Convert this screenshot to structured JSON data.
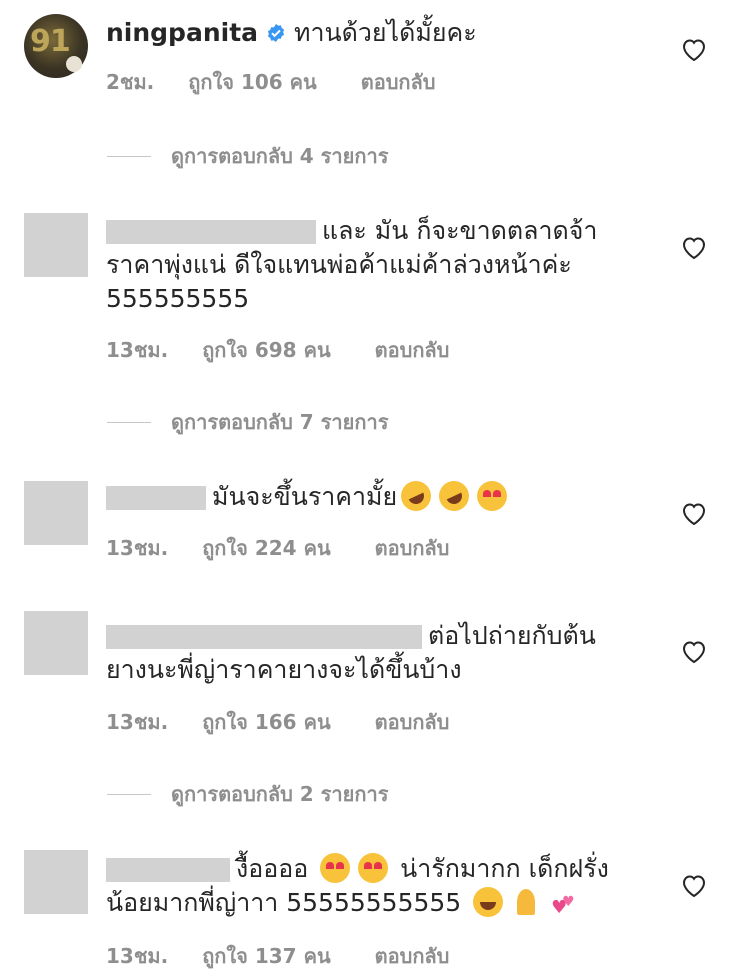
{
  "comments": [
    {
      "username": "ningpanita",
      "text": "ทานด้วยได้มั้ยคะ",
      "time": "2ชม.",
      "likes": "ถูกใจ 106 คน",
      "reply": "ตอบกลับ",
      "view_replies": "ดูการตอบกลับ 4 รายการ"
    },
    {
      "line1": "และ มัน ก็จะขาดตลาดจ้า",
      "line2": "ราคาพุ่งแน่ ดีใจแทนพ่อค้าแม่ค้าล่วงหน้าค่ะ",
      "line3": "555555555",
      "time": "13ชม.",
      "likes": "ถูกใจ 698 คน",
      "reply": "ตอบกลับ",
      "view_replies": "ดูการตอบกลับ 7 รายการ"
    },
    {
      "line1": "มันจะขึ้นราคามั้ย",
      "emojis": [
        "rofl-emoji",
        "rofl-emoji",
        "heart-eyes-emoji"
      ],
      "time": "13ชม.",
      "likes": "ถูกใจ 224 คน",
      "reply": "ตอบกลับ"
    },
    {
      "line1": "ต่อไปถ่ายกับต้น",
      "line2": "ยางนะพี่ญ่าราคายางจะได้ขึ้นบ้าง",
      "time": "13ชม.",
      "likes": "ถูกใจ 166 คน",
      "reply": "ตอบกลับ",
      "view_replies": "ดูการตอบกลับ 2 รายการ"
    },
    {
      "line1a": "งื้ออออ",
      "line1b": "น่ารักมากก เด็กฝรั่ง",
      "line2": "น้อยมากพี่ญ่าาา 55555555555",
      "emojis": [
        "heart-eyes-emoji",
        "heart-eyes-emoji",
        "laughing-emoji",
        "praying-hands-emoji",
        "two-hearts-emoji"
      ],
      "time": "13ชม.",
      "likes": "ถูกใจ 137 คน",
      "reply": "ตอบกลับ"
    }
  ],
  "colors": {
    "text": "#262626",
    "meta": "#8e8e8e",
    "verified": "#3897f0",
    "redaction": "#d2d2d2"
  }
}
